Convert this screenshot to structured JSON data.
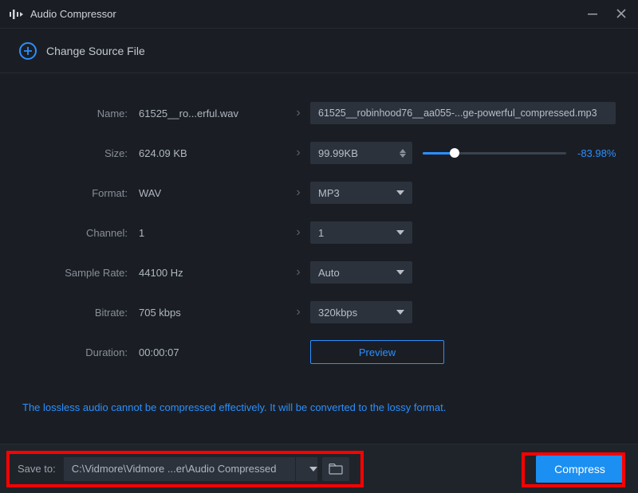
{
  "window": {
    "title": "Audio Compressor"
  },
  "source": {
    "change_label": "Change Source File"
  },
  "fields": {
    "name_label": "Name:",
    "name_value": "61525__ro...erful.wav",
    "name_output": "61525__robinhood76__aa055-...ge-powerful_compressed.mp3",
    "size_label": "Size:",
    "size_value": "624.09 KB",
    "size_output": "99.99KB",
    "size_pct": "-83.98%",
    "format_label": "Format:",
    "format_value": "WAV",
    "format_output": "MP3",
    "channel_label": "Channel:",
    "channel_value": "1",
    "channel_output": "1",
    "samplerate_label": "Sample Rate:",
    "samplerate_value": "44100 Hz",
    "samplerate_output": "Auto",
    "bitrate_label": "Bitrate:",
    "bitrate_value": "705 kbps",
    "bitrate_output": "320kbps",
    "duration_label": "Duration:",
    "duration_value": "00:00:07",
    "preview_label": "Preview"
  },
  "notice": "The lossless audio cannot be compressed effectively. It will be converted to the lossy format.",
  "bottom": {
    "save_label": "Save to:",
    "save_path": "C:\\Vidmore\\Vidmore ...er\\Audio Compressed",
    "compress_label": "Compress"
  }
}
